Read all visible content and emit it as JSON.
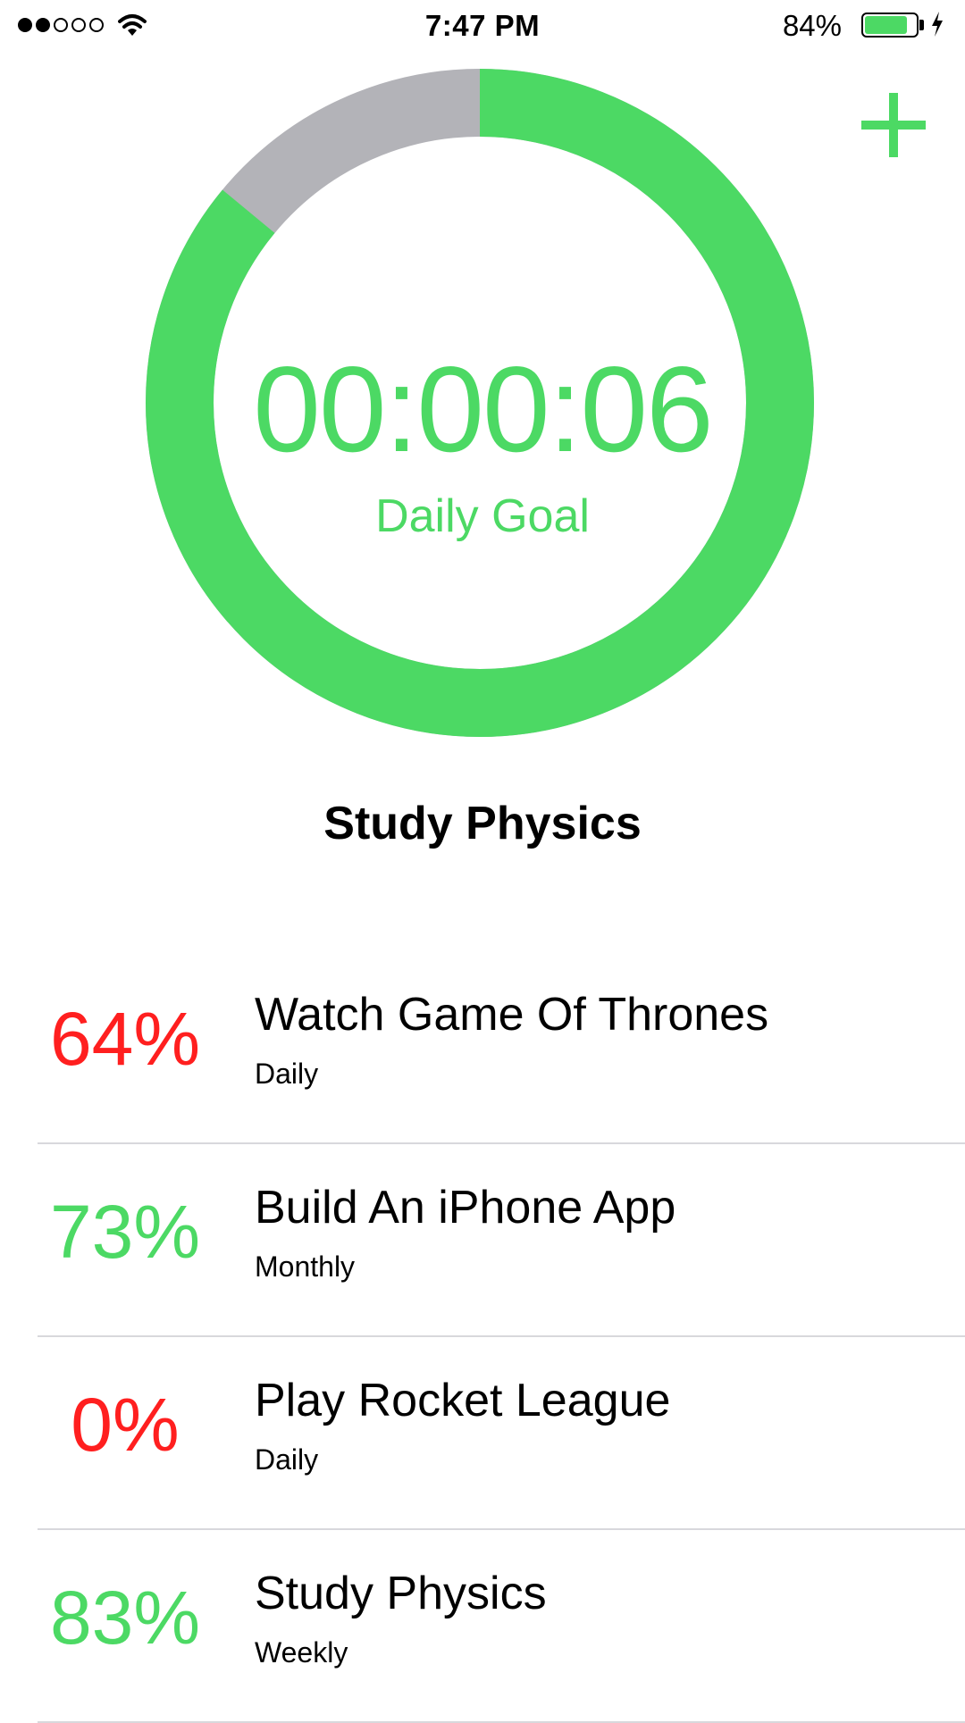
{
  "status_bar": {
    "signal_filled": 2,
    "signal_total": 5,
    "time": "7:47 PM",
    "battery_percent": "84%",
    "battery_level": 0.84,
    "charging": true
  },
  "colors": {
    "accent": "#4cd964",
    "ring_remaining": "#b3b3b8",
    "low_percent": "#ff1f1f",
    "text": "#000000"
  },
  "header": {
    "add_icon": "plus-icon"
  },
  "goal_ring": {
    "progress": 0.86,
    "timer": "00:00:06",
    "label": "Daily Goal"
  },
  "current_task": "Study Physics",
  "tasks": [
    {
      "percent": "64%",
      "percent_color": "#ff1f1f",
      "title": "Watch Game Of Thrones",
      "frequency": "Daily"
    },
    {
      "percent": "73%",
      "percent_color": "#4cd964",
      "title": "Build An iPhone App",
      "frequency": "Monthly"
    },
    {
      "percent": "0%",
      "percent_color": "#ff1f1f",
      "title": "Play Rocket League",
      "frequency": "Daily"
    },
    {
      "percent": "83%",
      "percent_color": "#4cd964",
      "title": "Study Physics",
      "frequency": "Weekly"
    }
  ]
}
